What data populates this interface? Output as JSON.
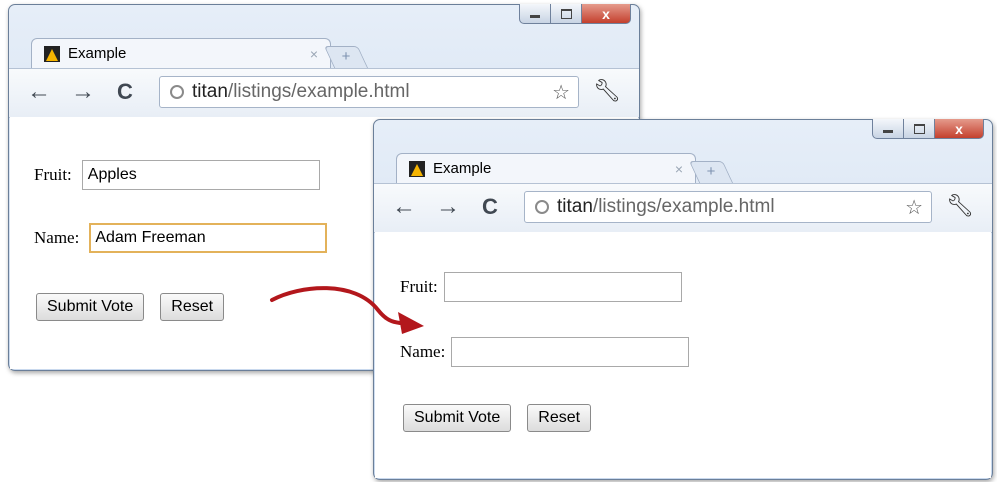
{
  "window1": {
    "tab_title": "Example",
    "tab_close": "×",
    "new_tab": "+",
    "url_host": "titan",
    "url_path": "/listings/example.html",
    "form": {
      "fruit_label": "Fruit:",
      "fruit_value": "Apples",
      "name_label": "Name:",
      "name_value": "Adam Freeman",
      "submit_label": "Submit Vote",
      "reset_label": "Reset"
    }
  },
  "window2": {
    "tab_title": "Example",
    "tab_close": "×",
    "new_tab": "+",
    "url_host": "titan",
    "url_path": "/listings/example.html",
    "form": {
      "fruit_label": "Fruit:",
      "fruit_value": "",
      "name_label": "Name:",
      "name_value": "",
      "submit_label": "Submit Vote",
      "reset_label": "Reset"
    }
  },
  "nav": {
    "back": "←",
    "forward": "→",
    "reload": "C",
    "star": "☆",
    "wrench": "🔧"
  },
  "colors": {
    "arrow": "#b3171c",
    "focus_border": "#e3b25a",
    "close_button": "#c4402e"
  }
}
